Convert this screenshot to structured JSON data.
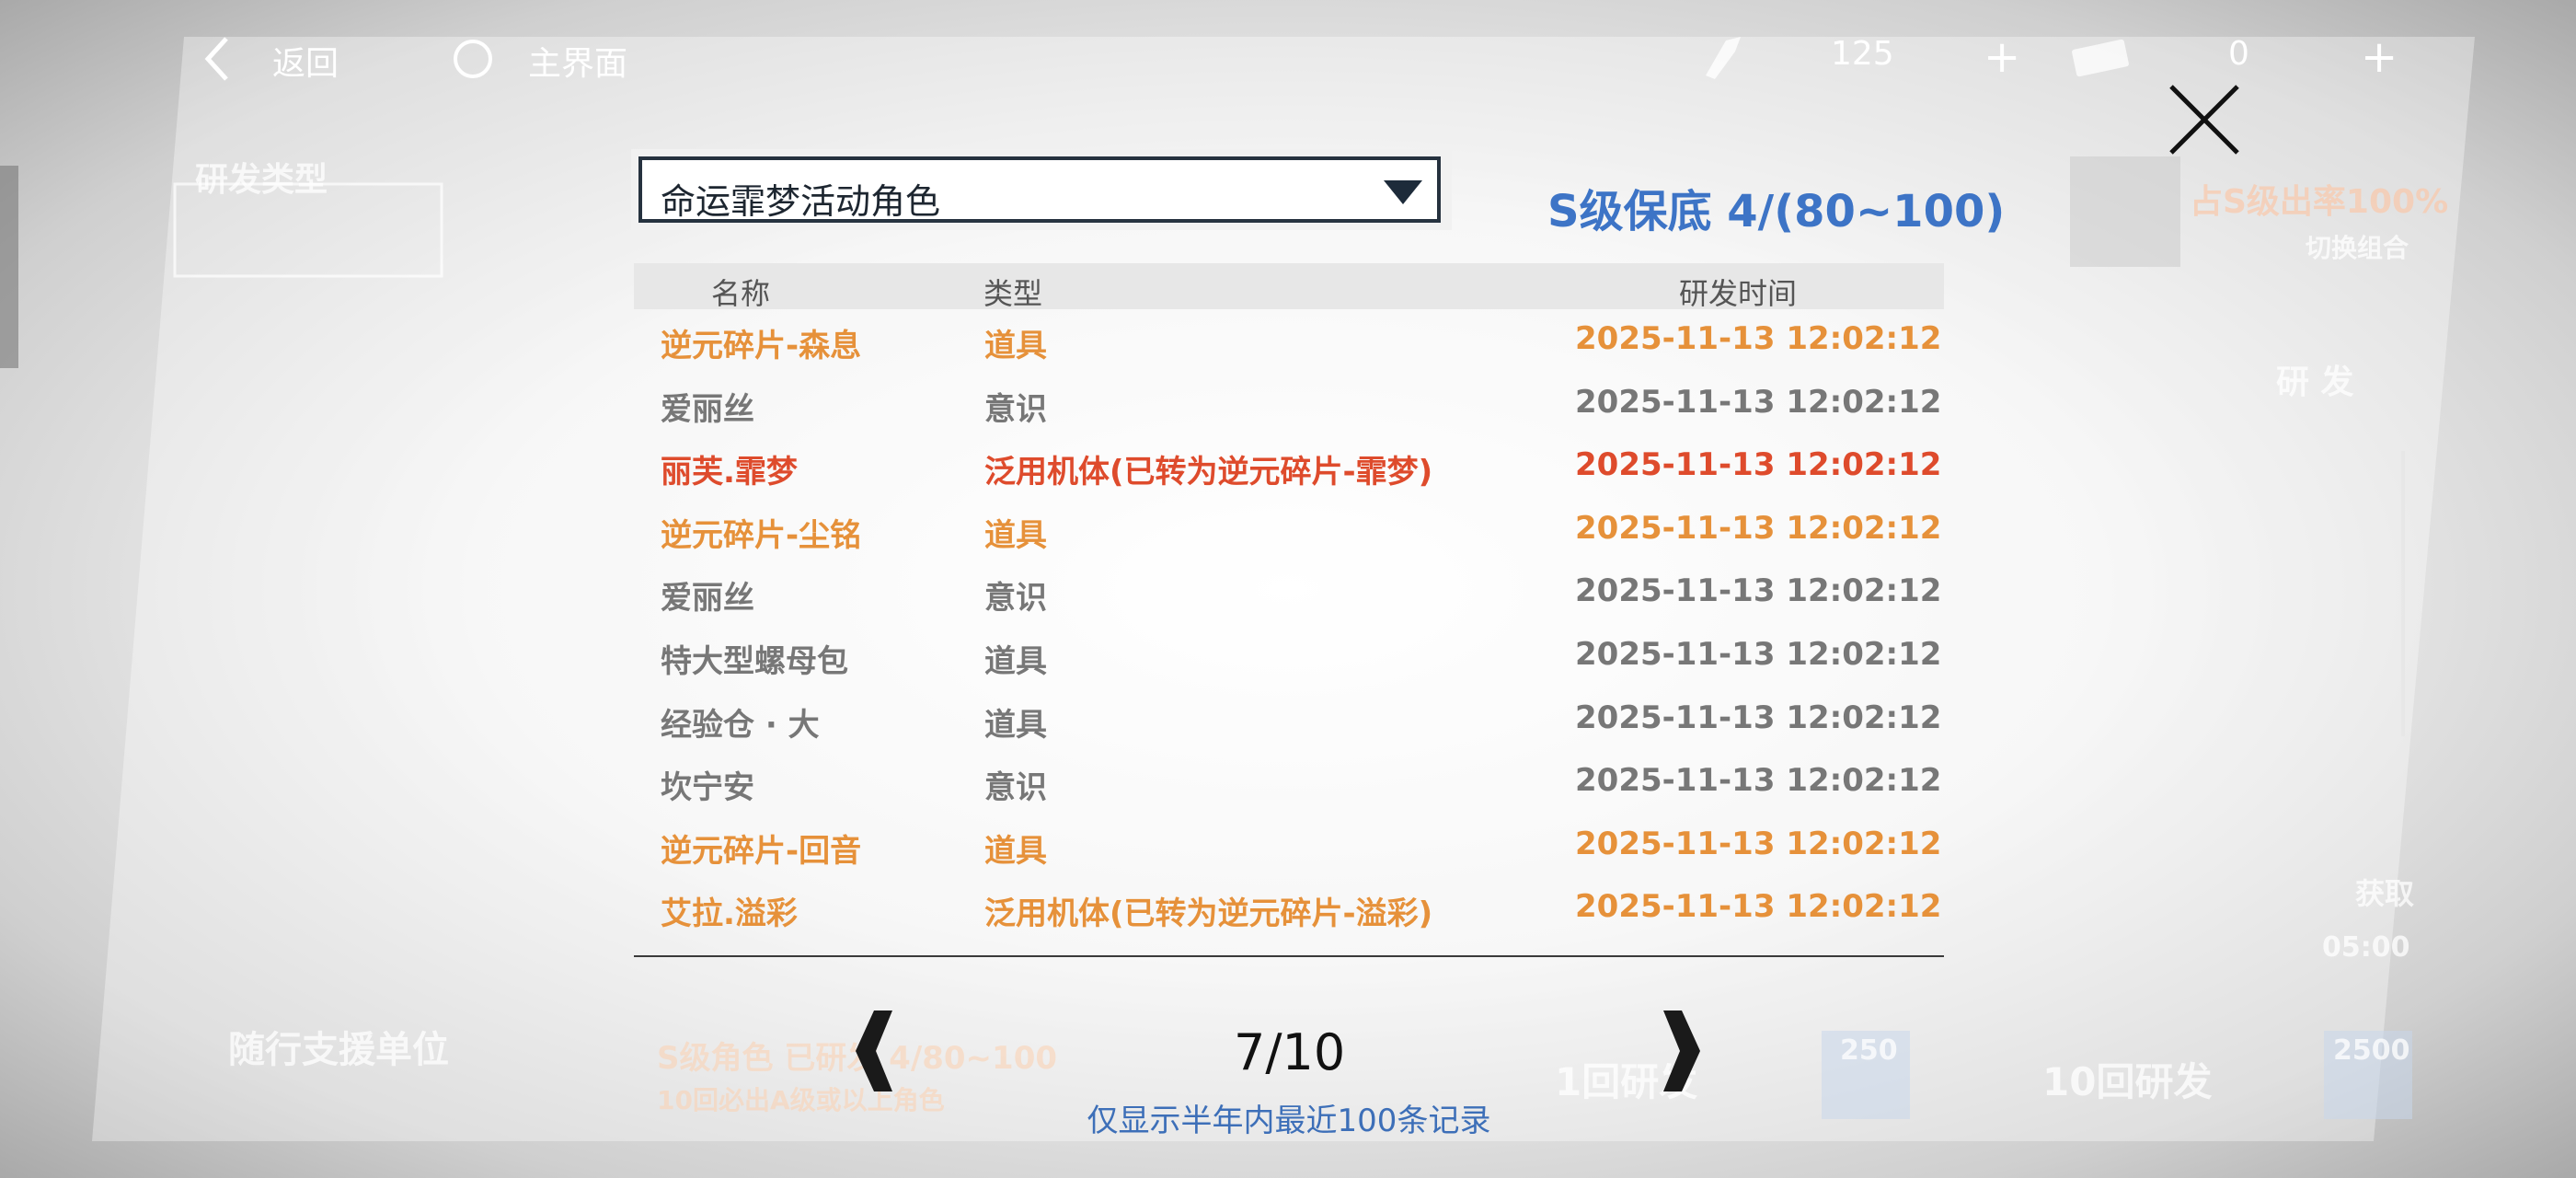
{
  "topbar": {
    "back_label": "返回",
    "home_label": "主界面",
    "currency1_amount": "125",
    "currency2_amount": "0",
    "plus_label": "+"
  },
  "background": {
    "research_type_label": "研发类型",
    "left_support_label": "随行支援单位",
    "switch_combo_label": "切换组合",
    "rate_label": "占S级出率100%",
    "research_tabs": "研  发",
    "s_grade_role": "S级角色  已研发 4/80~100",
    "ten_guarantee": "10回必出A级或以上角色",
    "draw_once_label": "1回研发",
    "draw_once_cost": "250",
    "draw_ten_label": "10回研发",
    "draw_ten_cost": "2500",
    "acquire_label": "获取",
    "time_label": "05:00"
  },
  "modal": {
    "pool_select": "命运霏梦活动角色",
    "pity_text": "S级保底 4/(80~100)",
    "columns": {
      "name": "名称",
      "type": "类型",
      "time": "研发时间"
    },
    "rows": [
      {
        "name": "逆元碎片-森息",
        "type": "道具",
        "time": "2025-11-13 12:02:12",
        "rarity": "orange"
      },
      {
        "name": "爱丽丝",
        "type": "意识",
        "time": "2025-11-13 12:02:12",
        "rarity": "gray"
      },
      {
        "name": "丽芙.霏梦",
        "type": "泛用机体(已转为逆元碎片-霏梦)",
        "time": "2025-11-13 12:02:12",
        "rarity": "red"
      },
      {
        "name": "逆元碎片-尘铭",
        "type": "道具",
        "time": "2025-11-13 12:02:12",
        "rarity": "orange"
      },
      {
        "name": "爱丽丝",
        "type": "意识",
        "time": "2025-11-13 12:02:12",
        "rarity": "gray"
      },
      {
        "name": "特大型螺母包",
        "type": "道具",
        "time": "2025-11-13 12:02:12",
        "rarity": "gray"
      },
      {
        "name": "经验仓 · 大",
        "type": "道具",
        "time": "2025-11-13 12:02:12",
        "rarity": "gray"
      },
      {
        "name": "坎宁安",
        "type": "意识",
        "time": "2025-11-13 12:02:12",
        "rarity": "gray"
      },
      {
        "name": "逆元碎片-回音",
        "type": "道具",
        "time": "2025-11-13 12:02:12",
        "rarity": "orange"
      },
      {
        "name": "艾拉.溢彩",
        "type": "泛用机体(已转为逆元碎片-溢彩)",
        "time": "2025-11-13 12:02:12",
        "rarity": "orange"
      }
    ],
    "page_indicator": "7/10",
    "notice": "仅显示半年内最近100条记录"
  },
  "colors": {
    "orange": "#e6913a",
    "gray": "#777777",
    "red": "#de4b2c",
    "blue": "#3d74c6"
  }
}
